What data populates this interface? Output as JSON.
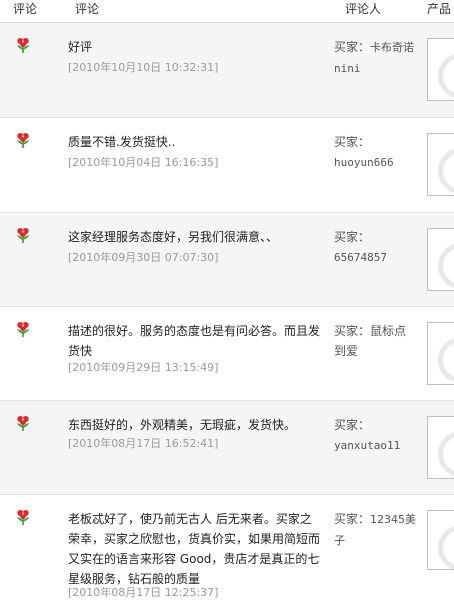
{
  "header": {
    "rating": "评论",
    "comment": "评论",
    "reviewer": "评论人",
    "product": "产品"
  },
  "colors": {
    "row_shade": "#f5f5f6",
    "timestamp": "#9a9a9a",
    "flower_red": "#e3262c",
    "flower_green": "#3f9b2f"
  },
  "reviews": [
    {
      "rating_icon": "red-flower-icon",
      "comment": "好评",
      "time": "[2010年10月10日 10:32:31]",
      "buyer_label": "买家：",
      "buyer_name": "卡布奇诺nini"
    },
    {
      "rating_icon": "red-flower-icon",
      "comment": "质量不错.发货挺快..",
      "time": "[2010年10月04日 16:16:35]",
      "buyer_label": "买家：",
      "buyer_name": "huoyun666"
    },
    {
      "rating_icon": "red-flower-icon",
      "comment": "这家经理服务态度好，另我们很满意、、",
      "time": "[2010年09月30日 07:07:30]",
      "buyer_label": "买家：",
      "buyer_name": "65674857"
    },
    {
      "rating_icon": "red-flower-icon",
      "comment": "描述的很好。服务的态度也是有问必答。而且发货快",
      "time": "[2010年09月29日 13:15:49]",
      "buyer_label": "买家：",
      "buyer_name": "鼠标点到爱"
    },
    {
      "rating_icon": "red-flower-icon",
      "comment": "东西挺好的，外观精美，无瑕疵，发货快。",
      "time": "[2010年08月17日 16:52:41]",
      "buyer_label": "买家：",
      "buyer_name": "yanxutao11"
    },
    {
      "rating_icon": "red-flower-icon",
      "comment": "老板忒好了，使乃前无古人 后无来者。买家之荣幸，买家之欣慰也，货真价实，如果用简短而又实在的语言来形容 Good，贵店才是真正的七星级服务，钻石般的质量",
      "time": "[2010年08月17日 12:25:37]",
      "buyer_label": "买家：",
      "buyer_name": "12345美子"
    }
  ]
}
